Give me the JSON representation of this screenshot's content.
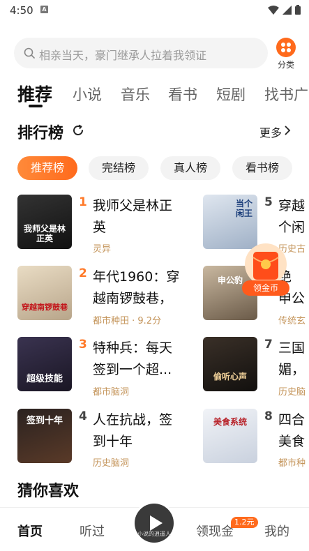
{
  "status": {
    "time": "4:50",
    "notif_icon_text": "A"
  },
  "search": {
    "placeholder": "相亲当天，豪门继承人拉着我领证"
  },
  "category": {
    "label": "分类"
  },
  "tabs": [
    "推荐",
    "小说",
    "音乐",
    "看书",
    "短剧",
    "找书广"
  ],
  "ranking": {
    "title": "排行榜",
    "more": "更多",
    "chips": [
      "推荐榜",
      "完结榜",
      "真人榜",
      "看书榜"
    ],
    "books_left": [
      {
        "rank": "1",
        "title_l1": "我师父是林正",
        "title_l2": "英",
        "meta": "灵异",
        "cover_text": "我师父是林正英"
      },
      {
        "rank": "2",
        "title_l1": "年代1960：穿",
        "title_l2": "越南锣鼓巷，",
        "meta": "都市种田 · 9.2分",
        "cover_text": "穿越南锣鼓巷"
      },
      {
        "rank": "3",
        "title_l1": "特种兵：每天",
        "title_l2": "签到一个超...",
        "meta": "都市脑洞",
        "cover_text": "超级技能"
      },
      {
        "rank": "4",
        "title_l1": "人在抗战，签",
        "title_l2": "到十年",
        "meta": "历史脑洞",
        "cover_text": "签到十年"
      }
    ],
    "books_right": [
      {
        "rank": "5",
        "title_l1": "穿越",
        "title_l2": "个闲",
        "meta": "历史古",
        "cover_text": "当个闲王"
      },
      {
        "rank": "6",
        "title_l1": "绝",
        "title_l2": "申公",
        "meta": "传统玄",
        "cover_text": "申公豹"
      },
      {
        "rank": "7",
        "title_l1": "三国",
        "title_l2": "媚，",
        "meta": "历史脑",
        "cover_text": "偷听心声"
      },
      {
        "rank": "8",
        "title_l1": "四合",
        "title_l2": "美食",
        "meta": "都市种",
        "cover_text": "美食系统"
      }
    ]
  },
  "reward": {
    "label": "领金币"
  },
  "guess": {
    "title": "猜你喜欢"
  },
  "bottom_nav": {
    "items": [
      "首页",
      "听过",
      "领现金",
      "我的"
    ],
    "badge": "1.2元",
    "player_text": "小说的逍遥人生"
  },
  "colors": {
    "accent": "#ff6a1c",
    "meta": "#c4945a",
    "rank": "#ff7a2a"
  }
}
